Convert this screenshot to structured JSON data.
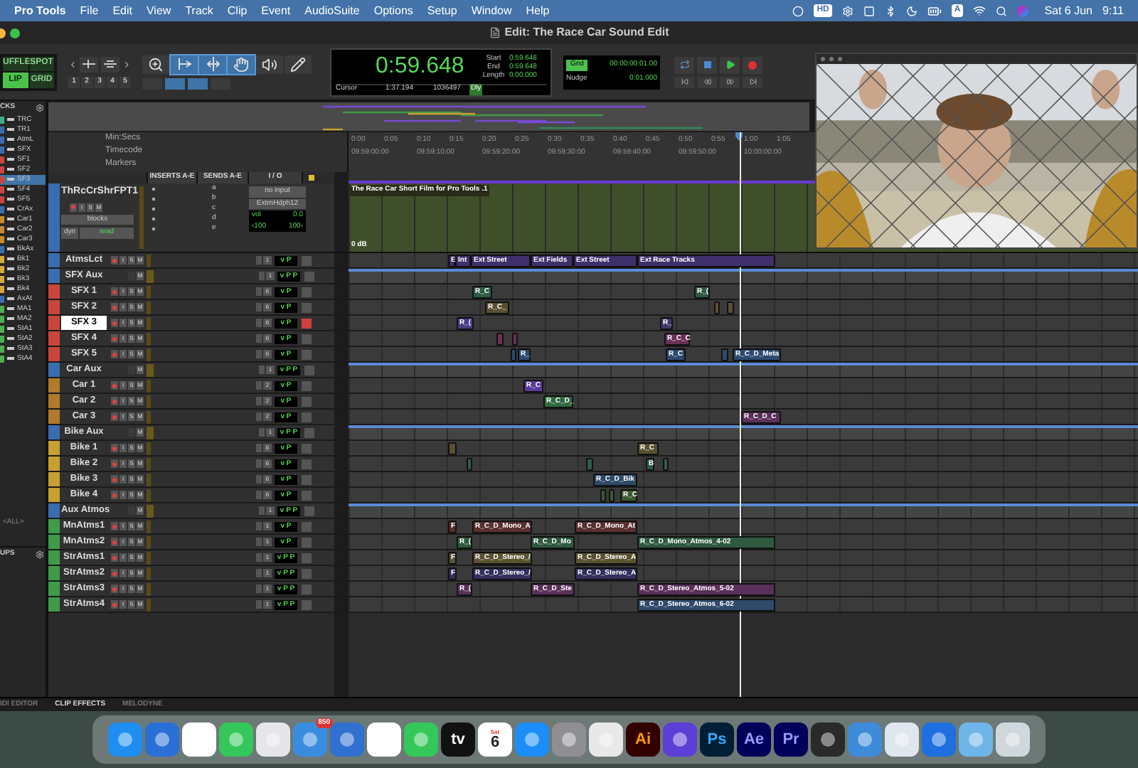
{
  "menu_bar": {
    "app": "Pro Tools",
    "items": [
      "File",
      "Edit",
      "View",
      "Track",
      "Clip",
      "Event",
      "AudioSuite",
      "Options",
      "Setup",
      "Window",
      "Help"
    ],
    "hd_badge": "HD",
    "input_source": "A",
    "date": "Sat 6 Jun",
    "time": "9:11"
  },
  "window": {
    "title": "Edit: The Race Car Sound Edit"
  },
  "toolbar": {
    "modes": [
      {
        "label": "UFFLE",
        "selected": false
      },
      {
        "label": "SPOT",
        "selected": false
      },
      {
        "label": "LIP",
        "selected": true
      },
      {
        "label": "GRID",
        "selected": false
      }
    ],
    "zoom_presets": [
      "1",
      "2",
      "3",
      "4",
      "5"
    ],
    "tools": [
      {
        "kind": "zoom",
        "selected": false
      },
      {
        "kind": "trim",
        "selected": true
      },
      {
        "kind": "select",
        "selected": true
      },
      {
        "kind": "grab",
        "selected": true
      },
      {
        "kind": "scrub",
        "selected": false
      },
      {
        "kind": "pencil",
        "selected": false
      }
    ],
    "counter": {
      "main": "0:59.648",
      "start_label": "Start",
      "start": "0:59.648",
      "end_label": "End",
      "end": "0:59.648",
      "length_label": "Length",
      "length": "0:00.000",
      "cursor_label": "Cursor",
      "cursor": "1:37.194",
      "sample": "1036497",
      "delay": "Dly"
    },
    "grid": {
      "label": "Grid",
      "value": "00:00:00:01.00",
      "nudge_label": "Nudge",
      "nudge": "0:01.000"
    }
  },
  "tracks_panel": {
    "title": "CKS",
    "items": [
      {
        "name": "TRC",
        "color": "#3fae8f",
        "selected": false
      },
      {
        "name": "TR1",
        "color": "#3a6db0",
        "selected": false
      },
      {
        "name": "AtmL",
        "color": "#3a6db0",
        "selected": false
      },
      {
        "name": "SFX",
        "color": "#3a6db0",
        "selected": false
      },
      {
        "name": "SF1",
        "color": "#c8463c",
        "selected": false
      },
      {
        "name": "SF2",
        "color": "#c8463c",
        "selected": false
      },
      {
        "name": "SF3",
        "color": "#c8463c",
        "selected": true
      },
      {
        "name": "SF4",
        "color": "#c8463c",
        "selected": false
      },
      {
        "name": "SF5",
        "color": "#c8463c",
        "selected": false
      },
      {
        "name": "CrAx",
        "color": "#3a6db0",
        "selected": false
      },
      {
        "name": "Car1",
        "color": "#c88a2e",
        "selected": false
      },
      {
        "name": "Car2",
        "color": "#c88a2e",
        "selected": false
      },
      {
        "name": "Car3",
        "color": "#c88a2e",
        "selected": false
      },
      {
        "name": "BkAx",
        "color": "#3a6db0",
        "selected": false
      },
      {
        "name": "Bk1",
        "color": "#d6a93a",
        "selected": false
      },
      {
        "name": "Bk2",
        "color": "#d6a93a",
        "selected": false
      },
      {
        "name": "Bk3",
        "color": "#d6a93a",
        "selected": false
      },
      {
        "name": "Bk4",
        "color": "#d6a93a",
        "selected": false
      },
      {
        "name": "AxAt",
        "color": "#3a6db0",
        "selected": false
      },
      {
        "name": "MA1",
        "color": "#4caf50",
        "selected": false
      },
      {
        "name": "MA2",
        "color": "#4caf50",
        "selected": false
      },
      {
        "name": "StA1",
        "color": "#4caf50",
        "selected": false
      },
      {
        "name": "StA2",
        "color": "#4caf50",
        "selected": false
      },
      {
        "name": "StA3",
        "color": "#4caf50",
        "selected": false
      },
      {
        "name": "StA4",
        "color": "#4caf50",
        "selected": false
      }
    ]
  },
  "groups_panel": {
    "title": "UPS",
    "items": [
      "<ALL>"
    ]
  },
  "rulers": {
    "labels": [
      "Min:Secs",
      "Timecode",
      "Markers"
    ],
    "min_secs": [
      "0:00",
      "0:05",
      "0:10",
      "0:15",
      "0:20",
      "0:25",
      "0:30",
      "0:35",
      "0:40",
      "0:45",
      "0:50",
      "0:55",
      "1:00",
      "1:05"
    ],
    "timecode": [
      "09:59:00:00",
      "09:59:10:00",
      "09:59:20:00",
      "09:59:30:00",
      "09:59:40:00",
      "09:59:50:00",
      "10:00:00:00"
    ]
  },
  "track_columns": [
    "INSERTS A-E",
    "SENDS A-E",
    "I / O"
  ],
  "video_track": {
    "name": "ThRcCrShrFPT1",
    "color": "#3a6db0",
    "buttons": [
      "I",
      "S",
      "M"
    ],
    "view": "blocks",
    "dyn": "dyn",
    "automation": "read",
    "sends": [
      "a",
      "b",
      "c",
      "d",
      "e"
    ],
    "input": "no input",
    "output": "ExtrnHdph12",
    "vol_label": "vol",
    "vol": "0.0",
    "pan_left": "‹100",
    "pan_right": "100›",
    "clip": "The Race Car Short Film for Pro Tools .1",
    "gain": "0 dB"
  },
  "tracks": [
    {
      "name": "AtmsLct",
      "kind": "audio",
      "color": "#3a6db0",
      "selected": false,
      "armed": false,
      "buttons": [
        "I",
        "S",
        "M"
      ],
      "input": "1",
      "auto": "v P",
      "clips": [
        {
          "label": "E",
          "color": "#3f2f6b"
        },
        {
          "label": "Int",
          "color": "#3f2f6b"
        },
        {
          "label": "Ext Street",
          "color": "#3f2f6b"
        },
        {
          "label": "Ext Fields",
          "color": "#3f2f6b"
        },
        {
          "label": "Ext Street",
          "color": "#3f2f6b"
        },
        {
          "label": "Ext Race Tracks",
          "color": "#3f2f6b"
        }
      ]
    },
    {
      "name": "SFX Aux",
      "kind": "aux",
      "color": "#3a6db0",
      "selected": false,
      "armed": false,
      "buttons": [
        "M"
      ],
      "input": "1",
      "auto": "v P P"
    },
    {
      "name": "SFX 1",
      "kind": "audio",
      "color": "#c8463c",
      "selected": false,
      "armed": false,
      "buttons": [
        "I",
        "S",
        "M"
      ],
      "input": "6",
      "auto": "v P",
      "clips": [
        {
          "label": "R_C",
          "color": "#2f5a45"
        },
        {
          "label": "R_(",
          "color": "#2f5a45"
        }
      ]
    },
    {
      "name": "SFX 2",
      "kind": "audio",
      "color": "#c8463c",
      "selected": false,
      "armed": false,
      "buttons": [
        "I",
        "S",
        "M"
      ],
      "input": "6",
      "auto": "v P",
      "clips": [
        {
          "label": "R_C_",
          "color": "#5a5030"
        },
        {
          "color": "#5a5030"
        },
        {
          "color": "#5a5030"
        }
      ]
    },
    {
      "name": "SFX 3",
      "kind": "audio",
      "color": "#c8463c",
      "selected": true,
      "armed": true,
      "buttons": [
        "I",
        "S",
        "M"
      ],
      "input": "6",
      "auto": "v P",
      "clips": [
        {
          "label": "R_(",
          "color": "#4b3a8a"
        },
        {
          "label": "R_",
          "color": "#3f3a6b"
        }
      ]
    },
    {
      "name": "SFX 4",
      "kind": "audio",
      "color": "#c8463c",
      "selected": false,
      "armed": false,
      "buttons": [
        "I",
        "S",
        "M"
      ],
      "input": "6",
      "auto": "v P",
      "clips": [
        {
          "color": "#6b3058"
        },
        {
          "color": "#6b3058"
        },
        {
          "label": "R_C_C",
          "color": "#6b3058"
        }
      ]
    },
    {
      "name": "SFX 5",
      "kind": "audio",
      "color": "#c8463c",
      "selected": false,
      "armed": false,
      "buttons": [
        "I",
        "S",
        "M"
      ],
      "input": "6",
      "auto": "v P",
      "clips": [
        {
          "color": "#2d4a70"
        },
        {
          "label": "R_",
          "color": "#2d4a70"
        },
        {
          "label": "R_C",
          "color": "#2d4a70"
        },
        {
          "color": "#2d4a70"
        },
        {
          "label": "R_C_D_Meta",
          "color": "#2d4a70"
        }
      ]
    },
    {
      "name": "Car Aux",
      "kind": "aux",
      "color": "#3a6db0",
      "selected": false,
      "armed": false,
      "buttons": [
        "M"
      ],
      "input": "1",
      "auto": "v P P"
    },
    {
      "name": "Car 1",
      "kind": "audio",
      "color": "#b07a2a",
      "selected": false,
      "armed": false,
      "buttons": [
        "I",
        "S",
        "M"
      ],
      "input": "2",
      "auto": "v P",
      "clips": [
        {
          "label": "R_C",
          "color": "#5a3a9a"
        }
      ]
    },
    {
      "name": "Car 2",
      "kind": "audio",
      "color": "#b07a2a",
      "selected": false,
      "armed": false,
      "buttons": [
        "I",
        "S",
        "M"
      ],
      "input": "2",
      "auto": "v P",
      "clips": [
        {
          "label": "R_C_D_",
          "color": "#2f6a40"
        }
      ]
    },
    {
      "name": "Car 3",
      "kind": "audio",
      "color": "#b07a2a",
      "selected": false,
      "armed": false,
      "buttons": [
        "I",
        "S",
        "M"
      ],
      "input": "2",
      "auto": "v P",
      "clips": [
        {
          "label": "R_C_D_C",
          "color": "#5a2f5a"
        }
      ]
    },
    {
      "name": "Bike Aux",
      "kind": "aux",
      "color": "#3a6db0",
      "selected": false,
      "armed": false,
      "buttons": [
        "M"
      ],
      "input": "1",
      "auto": "v P P"
    },
    {
      "name": "Bike 1",
      "kind": "audio",
      "color": "#c8a030",
      "selected": false,
      "armed": false,
      "buttons": [
        "I",
        "S",
        "M"
      ],
      "input": "6",
      "auto": "v P",
      "clips": [
        {
          "color": "#5a5030"
        },
        {
          "label": "R_C",
          "color": "#5a5030"
        }
      ]
    },
    {
      "name": "Bike 2",
      "kind": "audio",
      "color": "#c8a030",
      "selected": false,
      "armed": false,
      "buttons": [
        "I",
        "S",
        "M"
      ],
      "input": "6",
      "auto": "v P",
      "clips": [
        {
          "color": "#2f5a50"
        },
        {
          "color": "#2f5a50"
        },
        {
          "label": "B",
          "color": "#2f5a50"
        },
        {
          "color": "#2f5a50"
        }
      ]
    },
    {
      "name": "Bike 3",
      "kind": "audio",
      "color": "#c8a030",
      "selected": false,
      "armed": false,
      "buttons": [
        "I",
        "S",
        "M"
      ],
      "input": "6",
      "auto": "v P",
      "clips": [
        {
          "label": "R_C_D_Bik",
          "color": "#2d4a66"
        }
      ]
    },
    {
      "name": "Bike 4",
      "kind": "audio",
      "color": "#c8a030",
      "selected": false,
      "armed": false,
      "buttons": [
        "I",
        "S",
        "M"
      ],
      "input": "6",
      "auto": "v P",
      "clips": [
        {
          "color": "#3b5a30"
        },
        {
          "color": "#3b5a30"
        },
        {
          "label": "R_C",
          "color": "#3b5a30"
        }
      ]
    },
    {
      "name": "Aux Atmos",
      "kind": "aux",
      "color": "#3a6db0",
      "selected": false,
      "armed": false,
      "buttons": [
        "M"
      ],
      "input": "1",
      "auto": "v P P"
    },
    {
      "name": "MnAtms1",
      "kind": "audio",
      "color": "#3f9a4a",
      "selected": false,
      "armed": false,
      "buttons": [
        "I",
        "S",
        "M"
      ],
      "input": "1",
      "auto": "v P",
      "clips": [
        {
          "label": "F",
          "color": "#5a2f2f"
        },
        {
          "label": "R_C_D_Mono_A",
          "color": "#5a2f2f"
        },
        {
          "label": "R_C_D_Mono_At",
          "color": "#5a2f2f"
        }
      ]
    },
    {
      "name": "MnAtms2",
      "kind": "audio",
      "color": "#3f9a4a",
      "selected": false,
      "armed": false,
      "buttons": [
        "I",
        "S",
        "M"
      ],
      "input": "1",
      "auto": "v P",
      "clips": [
        {
          "label": "R_(",
          "color": "#2f5a3f"
        },
        {
          "label": "R_C_D_Mo",
          "color": "#2f5a3f"
        },
        {
          "label": "R_C_D_Mono_Atmos_4-02",
          "color": "#2f5a3f"
        }
      ]
    },
    {
      "name": "StrAtms1",
      "kind": "audio",
      "color": "#3f9a4a",
      "selected": false,
      "armed": false,
      "buttons": [
        "I",
        "S",
        "M"
      ],
      "input": "1",
      "auto": "v P P",
      "clips": [
        {
          "label": "F",
          "color": "#5a5230"
        },
        {
          "label": "R_C_D_Stereo_/",
          "color": "#5a5230"
        },
        {
          "label": "R_C_D_Stereo_A",
          "color": "#5a5230"
        }
      ]
    },
    {
      "name": "StrAtms2",
      "kind": "audio",
      "color": "#3f9a4a",
      "selected": false,
      "armed": false,
      "buttons": [
        "I",
        "S",
        "M"
      ],
      "input": "1",
      "auto": "v P P",
      "clips": [
        {
          "label": "F",
          "color": "#33305e"
        },
        {
          "label": "R_C_D_Stereo_/",
          "color": "#33305e"
        },
        {
          "label": "R_C_D_Stereo_A",
          "color": "#33305e"
        }
      ]
    },
    {
      "name": "StrAtms3",
      "kind": "audio",
      "color": "#3f9a4a",
      "selected": false,
      "armed": false,
      "buttons": [
        "I",
        "S",
        "M"
      ],
      "input": "1",
      "auto": "v P P",
      "clips": [
        {
          "label": "R_(",
          "color": "#5a2f5a"
        },
        {
          "label": "R_C_D_Ste",
          "color": "#5a2f5a"
        },
        {
          "label": "R_C_D_Stereo_Atmos_5-02",
          "color": "#5a2f5a"
        }
      ]
    },
    {
      "name": "StrAtms4",
      "kind": "audio",
      "color": "#3f9a4a",
      "selected": false,
      "armed": false,
      "buttons": [
        "I",
        "S",
        "M"
      ],
      "input": "1",
      "auto": "v P P",
      "clips": [
        {
          "label": "R_C_D_Stereo_Atmos_6-02",
          "color": "#2f4a6a"
        }
      ]
    }
  ],
  "bottom_tabs": [
    {
      "label": "IDI EDITOR",
      "selected": false
    },
    {
      "label": "CLIP EFFECTS",
      "selected": true
    },
    {
      "label": "MELODYNE",
      "selected": false
    }
  ],
  "dock": [
    {
      "kind": "compass"
    },
    {
      "kind": "swirl"
    },
    {
      "kind": "chrome"
    },
    {
      "kind": "messages"
    },
    {
      "kind": "launchpad"
    },
    {
      "kind": "mail",
      "badge": "850"
    },
    {
      "kind": "store"
    },
    {
      "kind": "photos"
    },
    {
      "kind": "facetime"
    },
    {
      "kind": "tv",
      "glyph": "tv"
    },
    {
      "kind": "calendar",
      "month": "Sat",
      "glyph": "6"
    },
    {
      "kind": "appstore"
    },
    {
      "kind": "settings"
    },
    {
      "kind": "blender"
    },
    {
      "kind": "illustrator",
      "glyph": "Ai"
    },
    {
      "kind": "protools"
    },
    {
      "kind": "photoshop",
      "glyph": "Ps"
    },
    {
      "kind": "aftereffects",
      "glyph": "Ae"
    },
    {
      "kind": "premiere",
      "glyph": "Pr"
    },
    {
      "kind": "resolve"
    },
    {
      "kind": "disk"
    },
    {
      "kind": "gearblue"
    },
    {
      "kind": "qapp"
    },
    {
      "kind": "folder"
    },
    {
      "kind": "trash"
    }
  ]
}
